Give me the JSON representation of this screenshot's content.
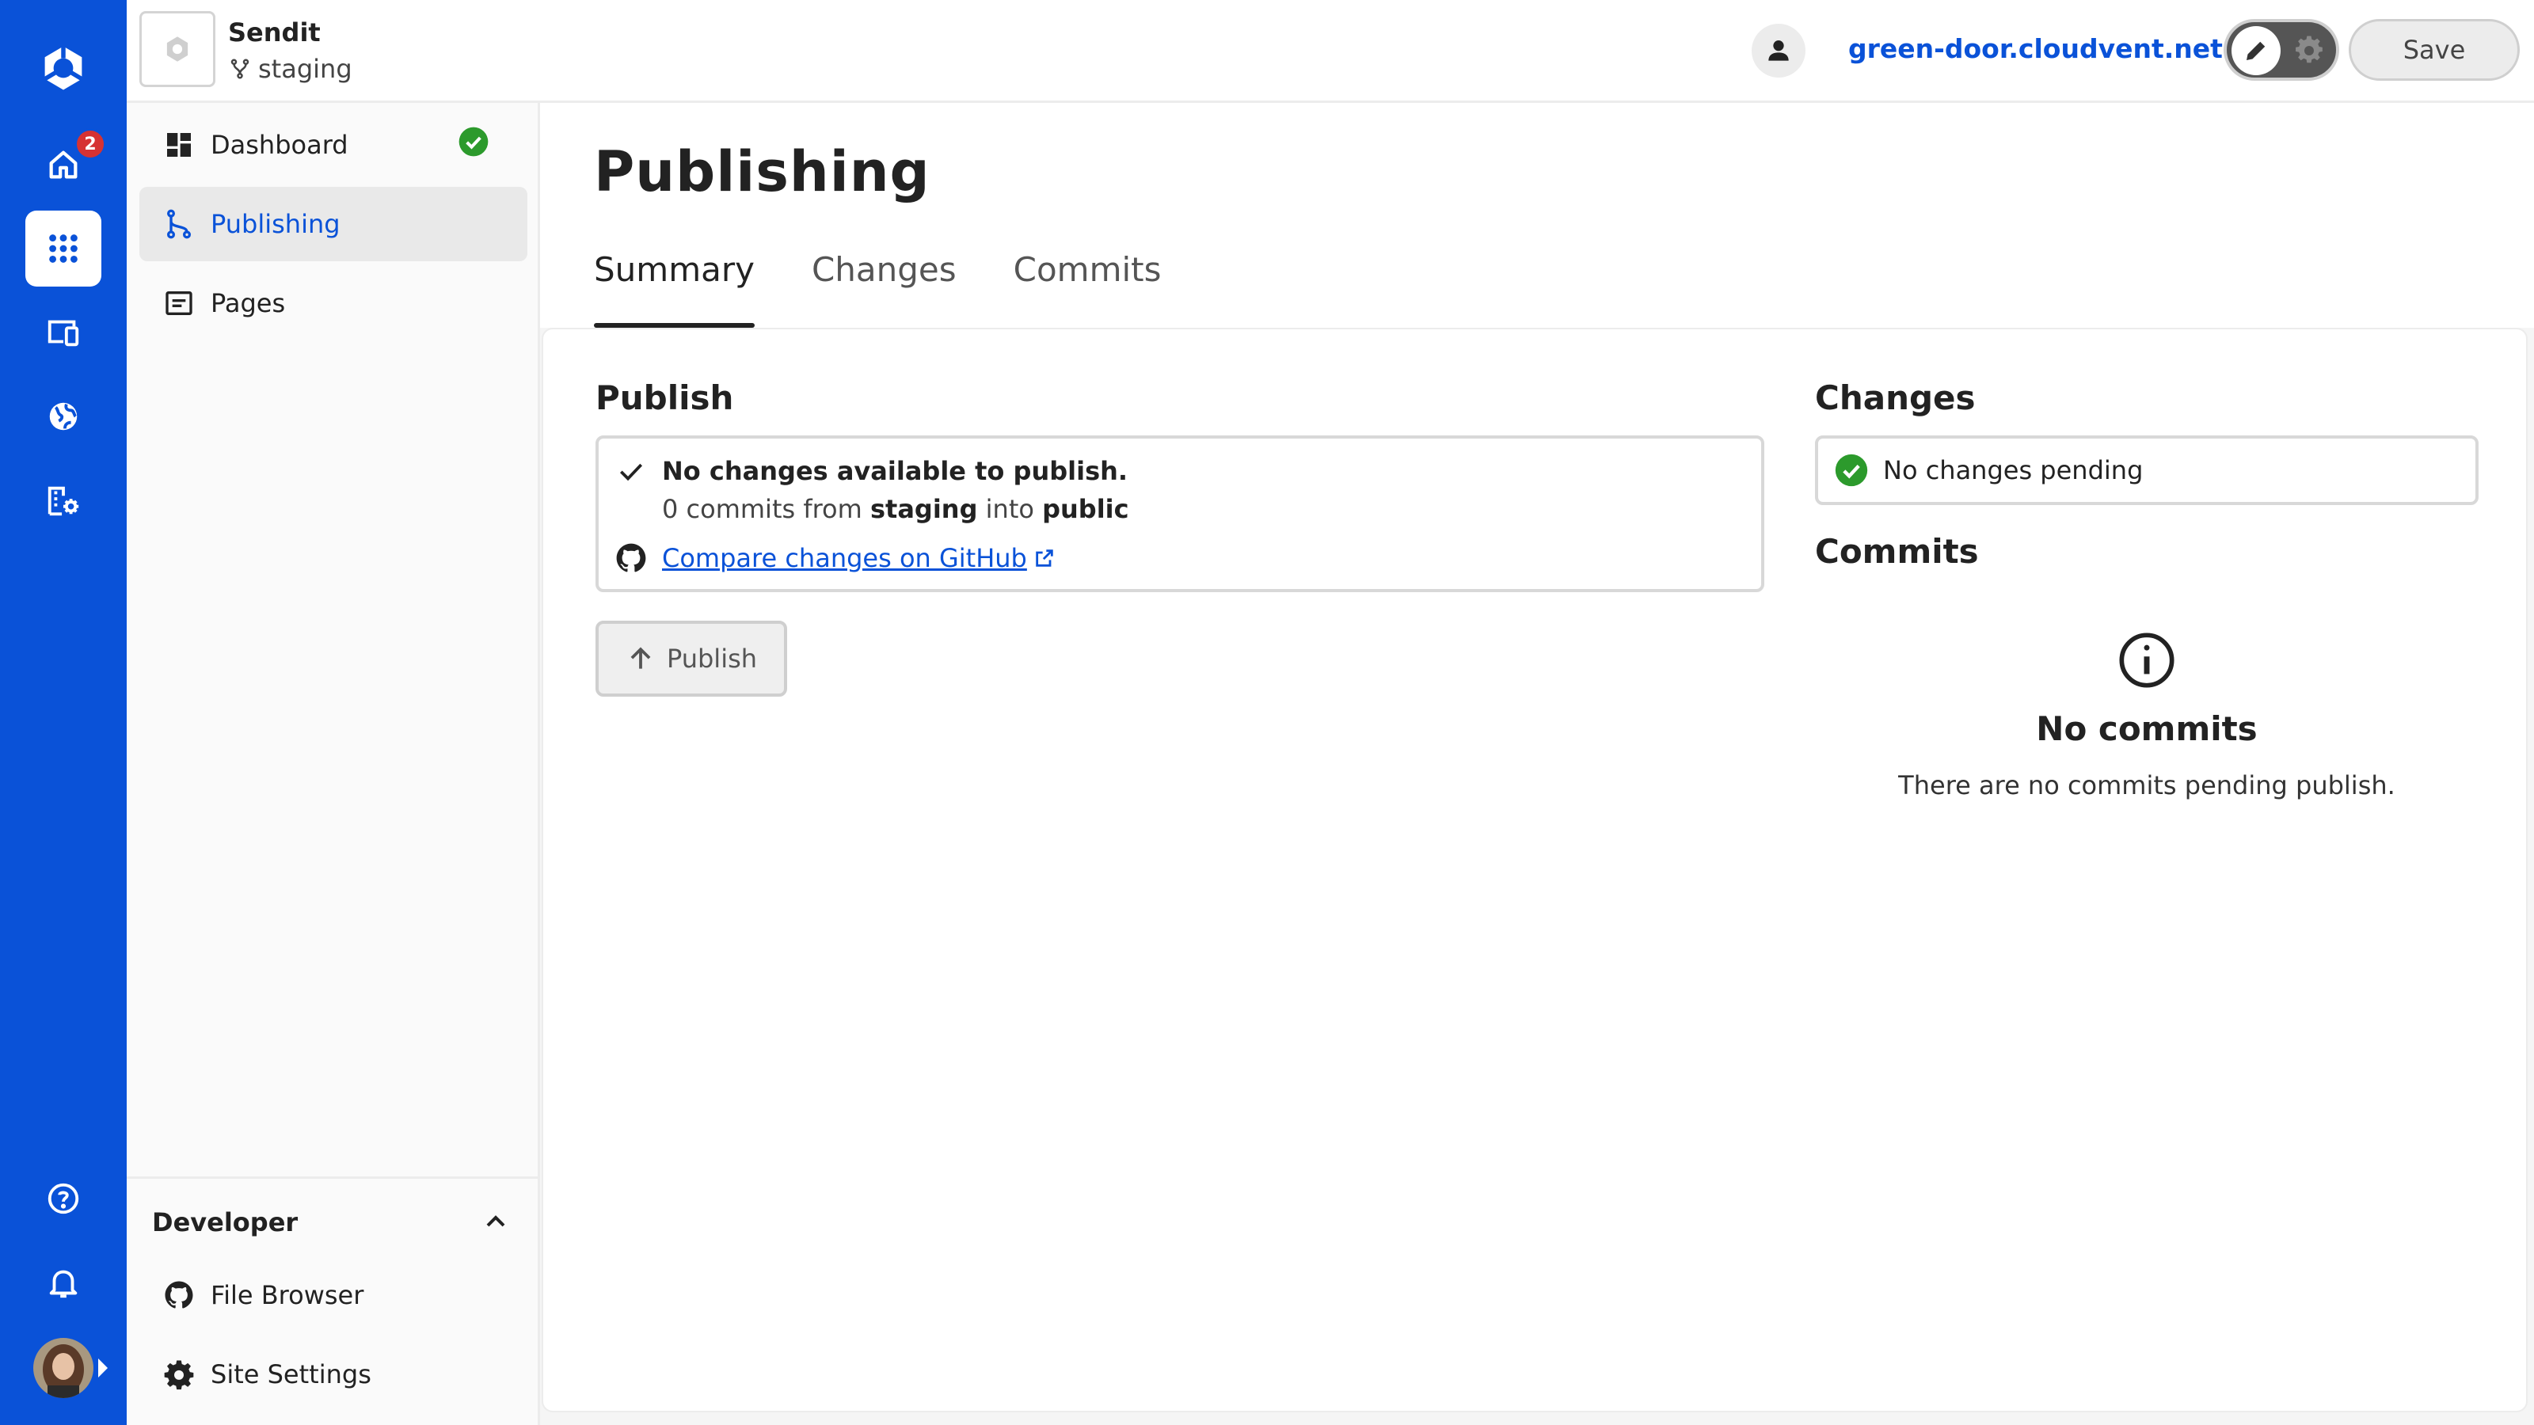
{
  "rail": {
    "badge_count": "2",
    "icons": [
      "home-icon",
      "apps-grid-icon",
      "devices-icon",
      "globe-icon",
      "buildings-settings-icon",
      "help-icon",
      "bell-icon"
    ]
  },
  "site": {
    "name": "Sendit",
    "branch": "staging",
    "url": "green-door.cloudvent.net"
  },
  "toolbar": {
    "save_label": "Save"
  },
  "sidenav": {
    "items": [
      {
        "label": "Dashboard"
      },
      {
        "label": "Publishing"
      },
      {
        "label": "Pages"
      }
    ],
    "developer": {
      "title": "Developer",
      "items": [
        {
          "label": "File Browser"
        },
        {
          "label": "Site Settings"
        }
      ]
    }
  },
  "main": {
    "title": "Publishing",
    "tabs": [
      {
        "label": "Summary"
      },
      {
        "label": "Changes"
      },
      {
        "label": "Commits"
      }
    ],
    "publish": {
      "title": "Publish",
      "status": "No changes available to publish.",
      "count": "0",
      "commits_text": "commits from",
      "from_branch": "staging",
      "into_text": "into",
      "to_branch": "public",
      "compare_link": "Compare changes on GitHub",
      "button_label": "Publish"
    },
    "changes": {
      "title": "Changes",
      "status": "No changes pending"
    },
    "commits": {
      "title": "Commits",
      "empty_title": "No commits",
      "empty_text": "There are no commits pending publish."
    }
  },
  "colors": {
    "brand_blue": "#0a52d8",
    "success_green": "#2c9a2c",
    "badge_red": "#d63232"
  }
}
